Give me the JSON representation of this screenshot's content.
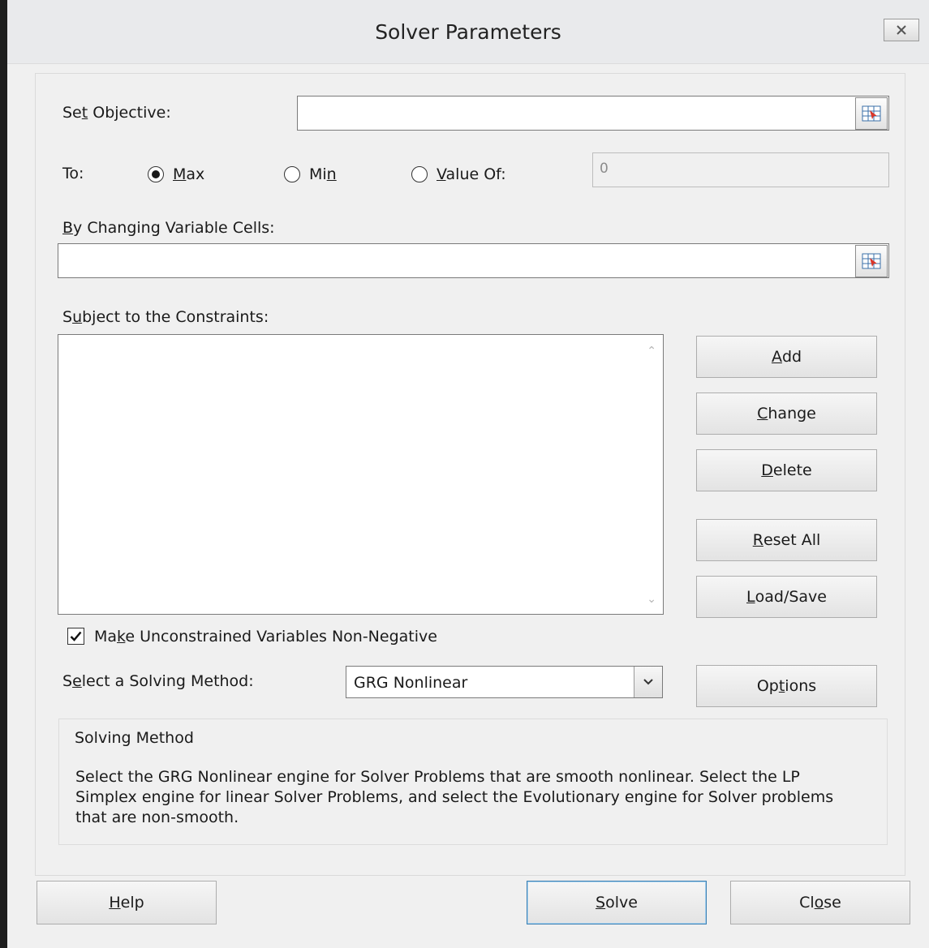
{
  "window": {
    "title": "Solver Parameters"
  },
  "objective": {
    "label_pre": "Se",
    "label_key": "t",
    "label_post": " Objective:",
    "value": ""
  },
  "to": {
    "label": "To:",
    "max": {
      "pre": "",
      "key": "M",
      "post": "ax",
      "selected": true
    },
    "min": {
      "pre": "Mi",
      "key": "n",
      "post": "",
      "selected": false
    },
    "value_of": {
      "pre": "",
      "key": "V",
      "post": "alue Of:",
      "selected": false
    },
    "value_of_value": "0"
  },
  "changing_cells": {
    "label_key": "B",
    "label_post": "y Changing Variable Cells:",
    "value": ""
  },
  "constraints": {
    "label_pre": "S",
    "label_key": "u",
    "label_post": "bject to the Constraints:",
    "items": []
  },
  "side_buttons": {
    "add": {
      "pre": "",
      "key": "A",
      "post": "dd"
    },
    "change": {
      "pre": "",
      "key": "C",
      "post": "hange"
    },
    "delete": {
      "pre": "",
      "key": "D",
      "post": "elete"
    },
    "reset_all": {
      "pre": "",
      "key": "R",
      "post": "eset All"
    },
    "load_save": {
      "pre": "",
      "key": "L",
      "post": "oad/Save"
    },
    "options": {
      "pre": "Op",
      "key": "t",
      "post": "ions"
    }
  },
  "nonneg": {
    "pre": "Ma",
    "key": "k",
    "post": "e Unconstrained Variables Non-Negative",
    "checked": true
  },
  "method": {
    "label_pre": "S",
    "label_key": "e",
    "label_post": "lect a Solving Method:",
    "selected": "GRG Nonlinear"
  },
  "solving_method_box": {
    "heading": "Solving Method",
    "description": "Select the GRG Nonlinear engine for Solver Problems that are smooth nonlinear. Select the LP Simplex engine for linear Solver Problems, and select the Evolutionary engine for Solver problems that are non-smooth."
  },
  "footer": {
    "help": {
      "pre": "",
      "key": "H",
      "post": "elp"
    },
    "solve": {
      "pre": "",
      "key": "S",
      "post": "olve"
    },
    "close": {
      "pre": "Cl",
      "key": "o",
      "post": "se"
    }
  }
}
